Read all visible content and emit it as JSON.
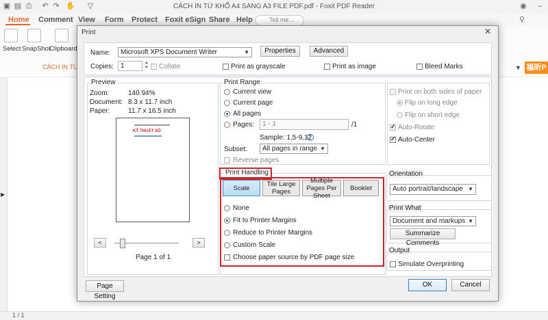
{
  "app": {
    "window_title": "CÁCH IN TỪ KHỔ A4 SANG A3 FILE PDF.pdf - Foxit PDF Reader",
    "menu": [
      "Home",
      "Comment",
      "View",
      "Form",
      "Protect",
      "Foxit eSign",
      "Share",
      "Help"
    ],
    "tell_me_placeholder": "Tell me...",
    "ribbon": [
      {
        "label": "Select"
      },
      {
        "label": "SnapShot"
      },
      {
        "label": "Clipboard"
      }
    ],
    "doc_tab": "CÁCH IN TỪ",
    "ad_text": "福昕P",
    "status_page": "1 / 1"
  },
  "dialog": {
    "title": "Print",
    "close_glyph": "✕",
    "printer": {
      "name_label": "Name:",
      "name_value": "Microsoft XPS Document Writer",
      "properties": "Properties",
      "advanced": "Advanced",
      "copies_label": "Copies:",
      "copies_value": "1",
      "collate": "Collate",
      "grayscale": "Print as grayscale",
      "as_image": "Print as image",
      "bleed_marks": "Bleed Marks"
    },
    "preview": {
      "title": "Preview",
      "zoom_label": "Zoom:",
      "zoom_value": "140.94%",
      "document_label": "Document:",
      "document_value": "8.3 x 11.7 inch",
      "paper_label": "Paper:",
      "paper_value": "11.7 x 16.5 inch",
      "thumb_heading": "KỸ THUẬT SỐ",
      "prev": "<",
      "next": ">",
      "page_of": "Page 1 of 1"
    },
    "range": {
      "title": "Print Range",
      "current_view": "Current view",
      "current_page": "Current page",
      "all_pages": "All pages",
      "pages_label": "Pages:",
      "pages_value": "1 - 1",
      "pages_total": "/1",
      "sample": "Sample: 1,5-9,12",
      "subset_label": "Subset:",
      "subset_value": "All pages in range",
      "reverse": "Reverse pages"
    },
    "handling": {
      "title": "Print Handling",
      "tabs": [
        "Scale",
        "Tile Large Pages",
        "Multiple Pages Per Sheet",
        "Booklet"
      ],
      "none": "None",
      "fit": "Fit to Printer Margins",
      "reduce": "Reduce to Printer Margins",
      "custom": "Custom Scale",
      "paper_source": "Choose paper source by PDF page size"
    },
    "duplex": {
      "both_sides": "Print on both sides of paper",
      "long_edge": "Flip on long edge",
      "short_edge": "Flip on short edge",
      "auto_rotate": "Auto-Rotate",
      "auto_center": "Auto-Center"
    },
    "orientation": {
      "title": "Orientation",
      "value": "Auto portrait/landscape"
    },
    "print_what": {
      "title": "Print What",
      "value": "Document and markups",
      "summarize": "Summarize Comments"
    },
    "output": {
      "title": "Output",
      "simulate": "Simulate Overprinting"
    },
    "page_setting": "Page Setting",
    "ok": "OK",
    "cancel": "Cancel"
  },
  "colors": {
    "accent": "#e0682b",
    "highlight_red": "#d0232a",
    "selected_blue": "#3a88c8"
  }
}
